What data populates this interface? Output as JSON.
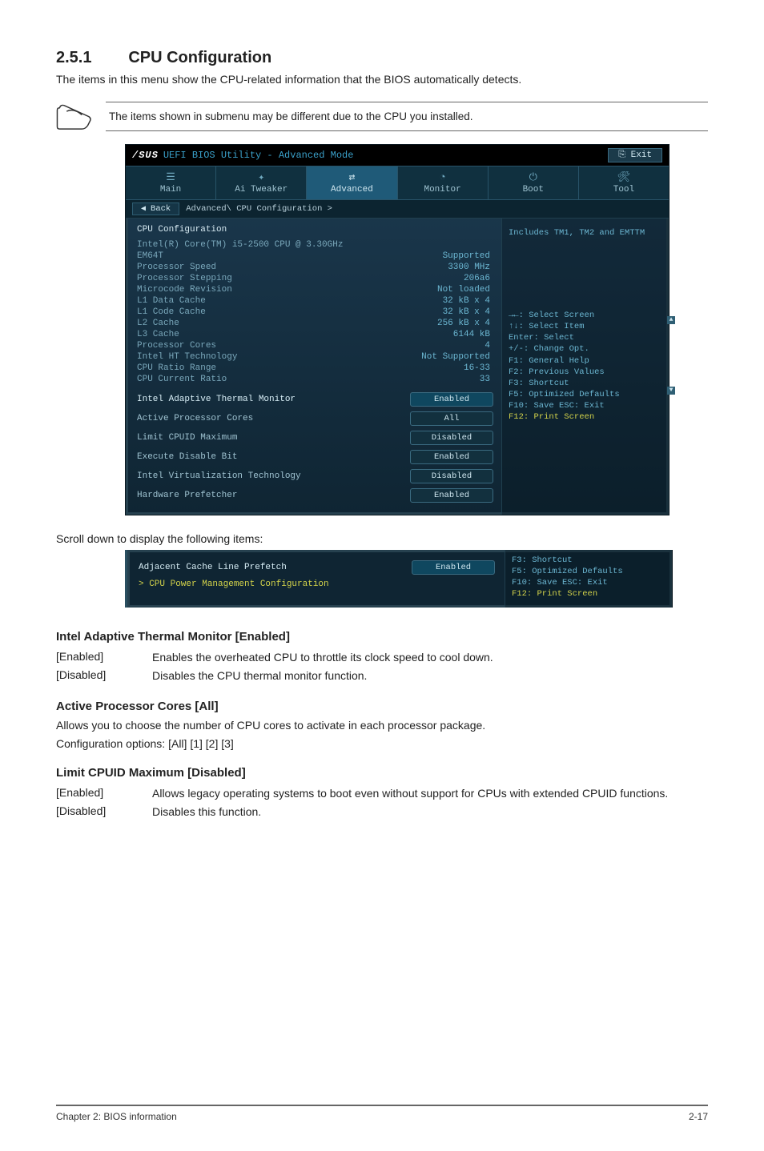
{
  "section": {
    "number": "2.5.1",
    "title": "CPU Configuration"
  },
  "intro": "The items in this menu show the CPU-related information that the BIOS automatically detects.",
  "note": "The items shown in submenu may be different due to the CPU you installed.",
  "bios": {
    "logo_brand": "/SUS",
    "logo_text": "UEFI BIOS Utility - Advanced Mode",
    "exit": "Exit",
    "tabs": {
      "main": "Main",
      "ai": "Ai Tweaker",
      "advanced": "Advanced",
      "monitor": "Monitor",
      "boot": "Boot",
      "tool": "Tool"
    },
    "back": "Back",
    "breadcrumb": "Advanced\\ CPU Configuration >",
    "panel_title": "CPU Configuration",
    "cpu_model": "Intel(R) Core(TM) i5-2500 CPU @ 3.30GHz",
    "info": [
      {
        "l": "EM64T",
        "r": "Supported"
      },
      {
        "l": "Processor Speed",
        "r": "3300 MHz"
      },
      {
        "l": "Processor Stepping",
        "r": "206a6"
      },
      {
        "l": "Microcode Revision",
        "r": "Not loaded"
      },
      {
        "l": "L1 Data Cache",
        "r": "32 kB x 4"
      },
      {
        "l": "L1 Code Cache",
        "r": "32 kB x 4"
      },
      {
        "l": "L2 Cache",
        "r": "256 kB x 4"
      },
      {
        "l": "L3 Cache",
        "r": "6144 kB"
      },
      {
        "l": "Processor Cores",
        "r": "4"
      },
      {
        "l": "Intel HT Technology",
        "r": "Not Supported"
      },
      {
        "l": "CPU Ratio Range",
        "r": "16-33"
      },
      {
        "l": "CPU Current Ratio",
        "r": "33"
      }
    ],
    "options": [
      {
        "l": "Intel Adaptive Thermal Monitor",
        "v": "Enabled",
        "hl": true
      },
      {
        "l": "Active Processor Cores",
        "v": "All"
      },
      {
        "l": "Limit CPUID Maximum",
        "v": "Disabled"
      },
      {
        "l": "Execute Disable Bit",
        "v": "Enabled"
      },
      {
        "l": "Intel Virtualization Technology",
        "v": "Disabled"
      },
      {
        "l": "Hardware Prefetcher",
        "v": "Enabled"
      }
    ],
    "right_hint": "Includes TM1, TM2 and EMTTM",
    "help": [
      "→←: Select Screen",
      "↑↓: Select Item",
      "Enter: Select",
      "+/-: Change Opt.",
      "F1: General Help",
      "F2: Previous Values",
      "F3: Shortcut",
      "F5: Optimized Defaults",
      "F10: Save  ESC: Exit",
      "F12: Print Screen"
    ]
  },
  "scroll_caption": "Scroll down to display the following items:",
  "strip": {
    "row1_label": "Adjacent Cache Line Prefetch",
    "row1_value": "Enabled",
    "row2_label": "> CPU Power Management Configuration",
    "help": [
      "F3: Shortcut",
      "F5: Optimized Defaults",
      "F10: Save  ESC: Exit",
      "F12: Print Screen"
    ]
  },
  "desc1": {
    "title": "Intel Adaptive Thermal Monitor [Enabled]",
    "rows": [
      {
        "k": "[Enabled]",
        "v": "Enables the overheated CPU to throttle its clock speed to cool down."
      },
      {
        "k": "[Disabled]",
        "v": "Disables the CPU thermal monitor function."
      }
    ]
  },
  "desc2": {
    "title": "Active Processor Cores [All]",
    "p1": "Allows you to choose the number of CPU cores to activate in each processor package.",
    "p2": "Configuration options: [All] [1] [2] [3]"
  },
  "desc3": {
    "title": "Limit CPUID Maximum [Disabled]",
    "rows": [
      {
        "k": "[Enabled]",
        "v": "Allows legacy operating systems to boot even without support for CPUs with extended CPUID functions."
      },
      {
        "k": "[Disabled]",
        "v": "Disables this function."
      }
    ]
  },
  "footer": {
    "left": "Chapter 2: BIOS information",
    "right": "2-17"
  }
}
